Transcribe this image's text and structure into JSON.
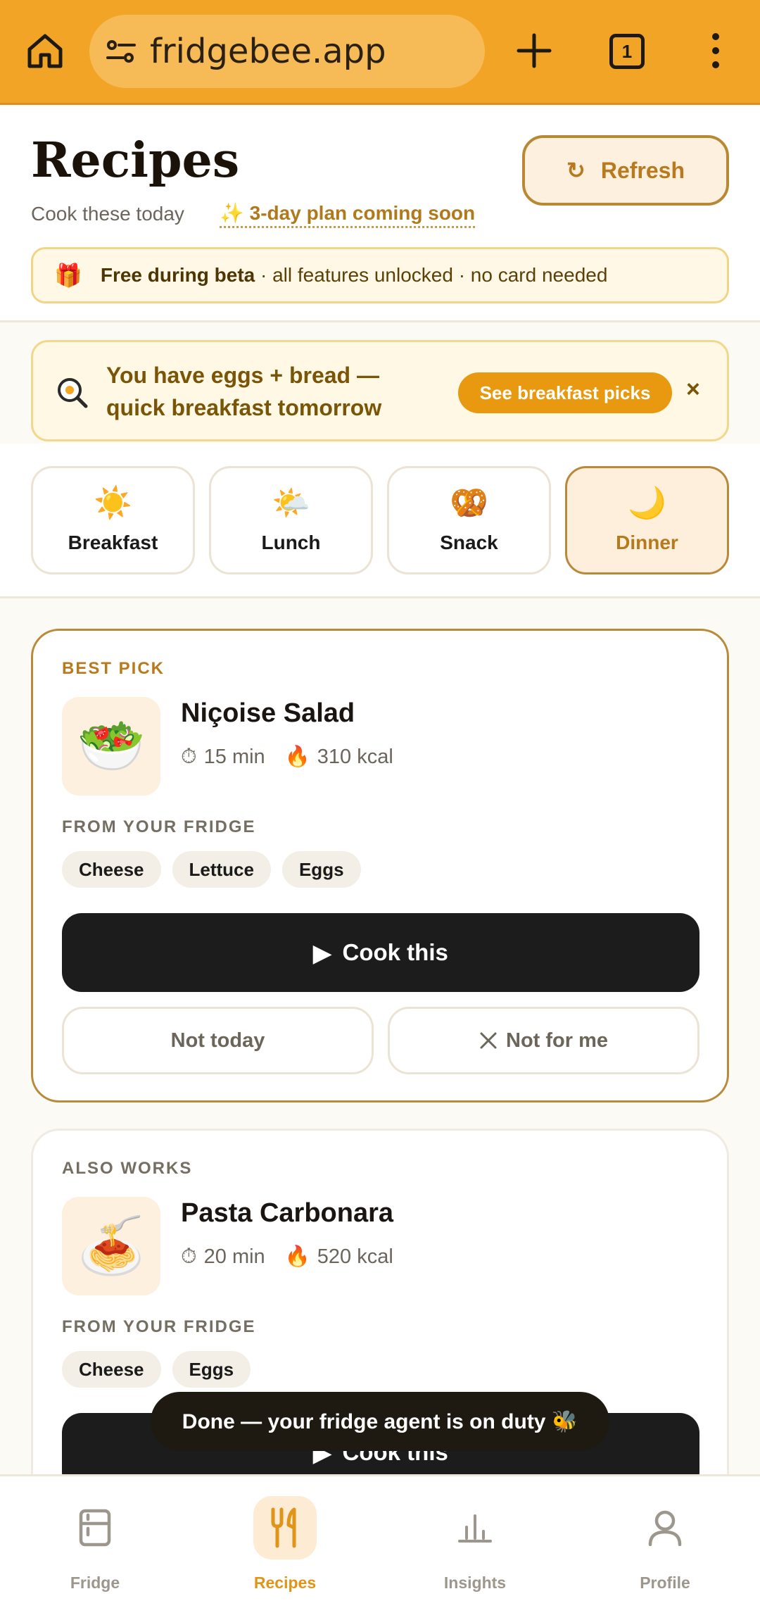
{
  "browser": {
    "url": "fridgebee.app",
    "tab_count": "1"
  },
  "header": {
    "title": "Recipes",
    "subtitle": "Cook these today",
    "plan_link": "✨ 3-day plan coming soon",
    "refresh_label": "Refresh",
    "refresh_glyph": "↻"
  },
  "beta_banner": {
    "icon": "🎁",
    "bold": "Free during beta",
    "rest": " · all features unlocked · no card needed"
  },
  "suggestion": {
    "text": "You have eggs + bread — quick breakfast tomorrow",
    "button": "See breakfast picks",
    "close": "×"
  },
  "meal_tabs": [
    {
      "emoji": "☀️",
      "label": "Breakfast",
      "active": false
    },
    {
      "emoji": "🌤️",
      "label": "Lunch",
      "active": false
    },
    {
      "emoji": "🥨",
      "label": "Snack",
      "active": false
    },
    {
      "emoji": "🌙",
      "label": "Dinner",
      "active": true
    }
  ],
  "cards": [
    {
      "tag": "BEST PICK",
      "emoji": "🥗",
      "name": "Niçoise Salad",
      "time": "15 min",
      "kcal": "310 kcal",
      "fridge_label": "FROM YOUR FRIDGE",
      "chips": [
        "Cheese",
        "Lettuce",
        "Eggs"
      ],
      "cook_label": "Cook this",
      "not_today": "Not today",
      "not_for_me": "Not for me"
    },
    {
      "tag": "ALSO WORKS",
      "emoji": "🍝",
      "name": "Pasta Carbonara",
      "time": "20 min",
      "kcal": "520 kcal",
      "fridge_label": "FROM YOUR FRIDGE",
      "chips": [
        "Cheese",
        "Eggs"
      ],
      "cook_label": "Cook this"
    }
  ],
  "toast": "Done — your fridge agent is on duty 🐝",
  "bottom_nav": [
    {
      "label": "Fridge",
      "icon": "fridge-icon",
      "active": false
    },
    {
      "label": "Recipes",
      "icon": "utensils-icon",
      "active": true
    },
    {
      "label": "Insights",
      "icon": "bar-chart-icon",
      "active": false
    },
    {
      "label": "Profile",
      "icon": "person-icon",
      "active": false
    }
  ],
  "colors": {
    "accent": "#f2a426",
    "accent_text": "#b87a1c",
    "dark_button": "#1d1c1c"
  }
}
